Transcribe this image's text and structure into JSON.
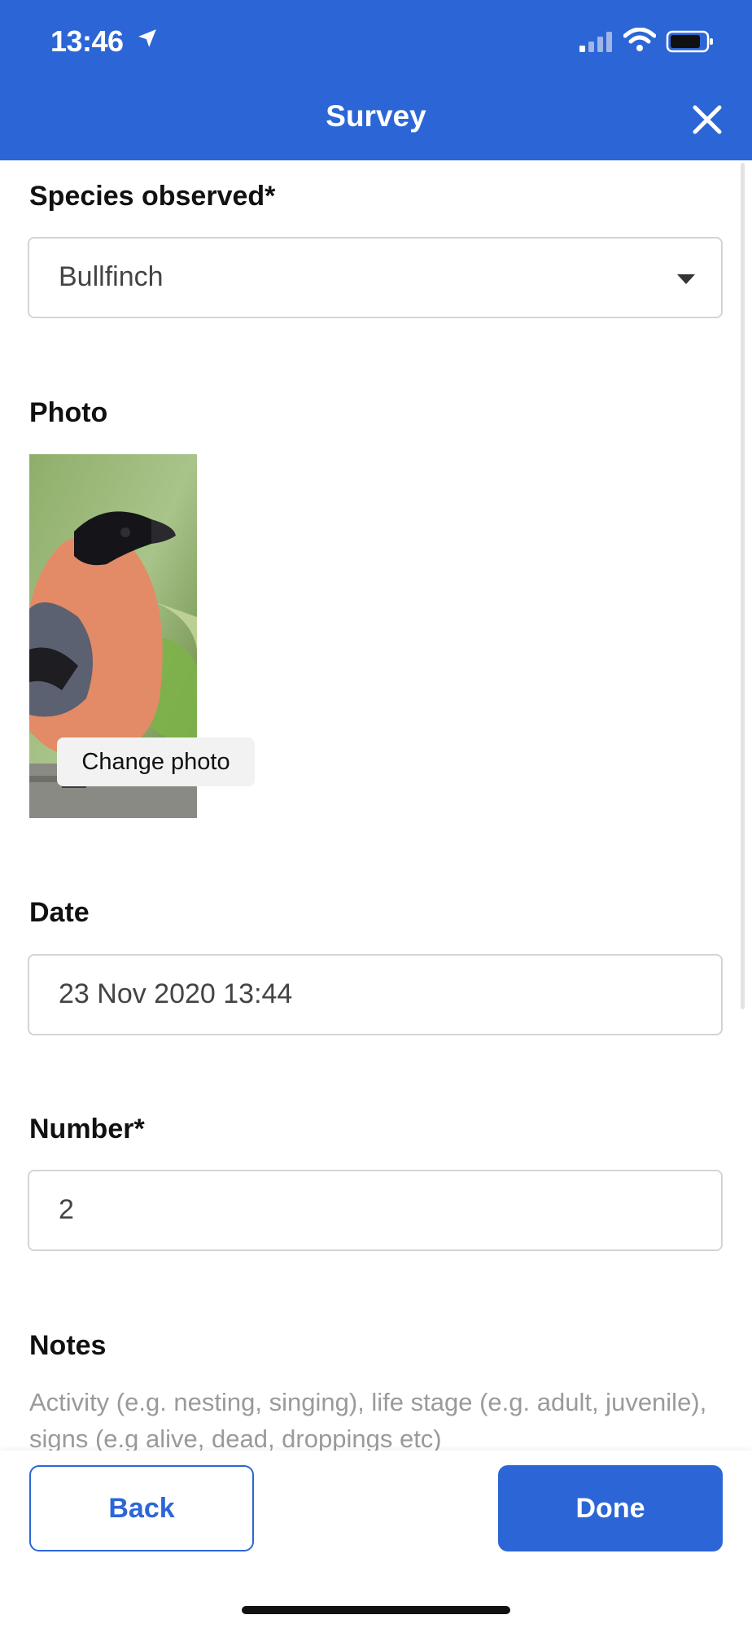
{
  "status_bar": {
    "time": "13:46"
  },
  "header": {
    "title": "Survey"
  },
  "species": {
    "label": "Species observed",
    "required_mark": "*",
    "value": "Bullfinch"
  },
  "photo": {
    "label": "Photo",
    "change_label": "Change photo"
  },
  "date": {
    "label": "Date",
    "value": "23 Nov 2020 13:44"
  },
  "number": {
    "label": "Number",
    "required_mark": "*",
    "value": "2"
  },
  "notes": {
    "label": "Notes",
    "placeholder": "Activity (e.g. nesting, singing), life stage (e.g. adult, juvenile), signs (e.g alive, dead, droppings etc)"
  },
  "footer": {
    "back_label": "Back",
    "done_label": "Done"
  },
  "colors": {
    "accent": "#2c66d6",
    "background": "#ffffff"
  }
}
